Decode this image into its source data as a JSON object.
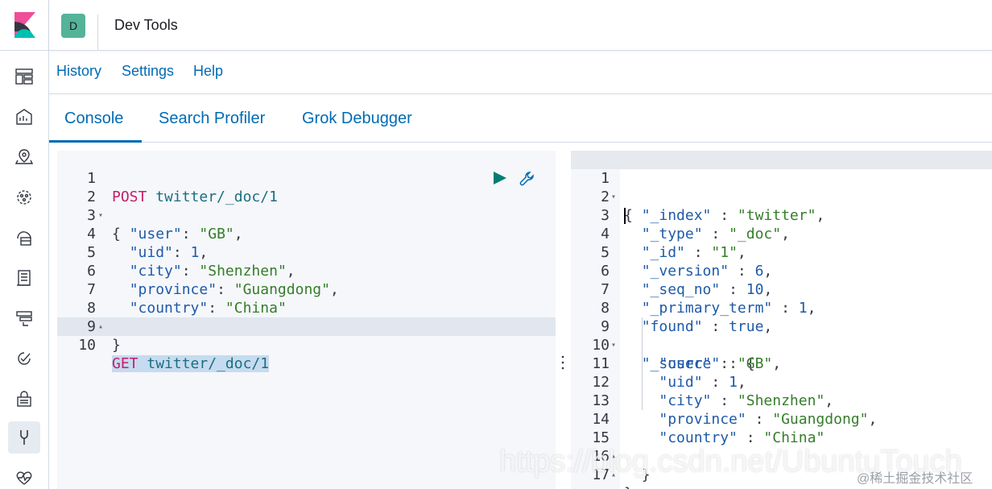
{
  "header": {
    "avatar_letter": "D",
    "title": "Dev Tools"
  },
  "sidenav": {
    "icons": [
      "dashboard-icon",
      "canvas-icon",
      "maps-icon",
      "ml-icon",
      "infrastructure-icon",
      "logs-icon",
      "apm-icon",
      "uptime-icon",
      "siem-icon",
      "dev-tools-icon",
      "monitoring-icon"
    ],
    "active": "dev-tools-icon"
  },
  "topmenu": {
    "history": "History",
    "settings": "Settings",
    "help": "Help"
  },
  "tabs": {
    "console": "Console",
    "search_profiler": "Search Profiler",
    "grok_debugger": "Grok Debugger"
  },
  "request_editor": {
    "line_numbers": [
      "1",
      "2",
      "3",
      "4",
      "5",
      "6",
      "7",
      "8",
      "9",
      "10"
    ],
    "line1": {
      "method": "POST",
      "url": "twitter/_doc/1"
    },
    "line2": "{",
    "line3": {
      "key": "\"user\"",
      "sep": ": ",
      "value": "\"GB\"",
      "end": ","
    },
    "line4": {
      "key": "\"uid\"",
      "sep": ": ",
      "value": "1",
      "end": ","
    },
    "line5": {
      "key": "\"city\"",
      "sep": ": ",
      "value": "\"Shenzhen\"",
      "end": ","
    },
    "line6": {
      "key": "\"province\"",
      "sep": ": ",
      "value": "\"Guangdong\"",
      "end": ","
    },
    "line7": {
      "key": "\"country\"",
      "sep": ": ",
      "value": "\"China\"",
      "end": ""
    },
    "line8": "}",
    "line10": {
      "method": "GET",
      "url": "twitter/_doc/1"
    }
  },
  "response_editor": {
    "line_numbers": [
      "1",
      "2",
      "3",
      "4",
      "5",
      "6",
      "7",
      "8",
      "9",
      "10",
      "11",
      "12",
      "13",
      "14",
      "15",
      "16",
      "17"
    ],
    "line1": "{",
    "line2": {
      "key": "\"_index\"",
      "sep": " : ",
      "value": "\"twitter\"",
      "end": ","
    },
    "line3": {
      "key": "\"_type\"",
      "sep": " : ",
      "value": "\"_doc\"",
      "end": ","
    },
    "line4": {
      "key": "\"_id\"",
      "sep": " : ",
      "value": "\"1\"",
      "end": ","
    },
    "line5": {
      "key": "\"_version\"",
      "sep": " : ",
      "value": "6",
      "end": ","
    },
    "line6": {
      "key": "\"_seq_no\"",
      "sep": " : ",
      "value": "10",
      "end": ","
    },
    "line7": {
      "key": "\"_primary_term\"",
      "sep": " : ",
      "value": "1",
      "end": ","
    },
    "line8": {
      "key": "\"found\"",
      "sep": " : ",
      "value": "true",
      "end": ","
    },
    "line9": {
      "key": "\"_source\"",
      "sep": " : ",
      "value": "{",
      "end": ""
    },
    "line10": {
      "key": "\"user\"",
      "sep": " : ",
      "value": "\"GB\"",
      "end": ","
    },
    "line11": {
      "key": "\"uid\"",
      "sep": " : ",
      "value": "1",
      "end": ","
    },
    "line12": {
      "key": "\"city\"",
      "sep": " : ",
      "value": "\"Shenzhen\"",
      "end": ","
    },
    "line13": {
      "key": "\"province\"",
      "sep": " : ",
      "value": "\"Guangdong\"",
      "end": ","
    },
    "line14": {
      "key": "\"country\"",
      "sep": " : ",
      "value": "\"China\"",
      "end": ""
    },
    "line15": "}",
    "line16": "}"
  },
  "watermarks": {
    "csdn": "https://blog.csdn.net/UbuntuTouch",
    "juejin": "@稀土掘金技术社区"
  },
  "colors": {
    "accent": "#006bb4",
    "method": "#c61e6a",
    "string": "#357d2a",
    "key": "#1f5aa8"
  }
}
